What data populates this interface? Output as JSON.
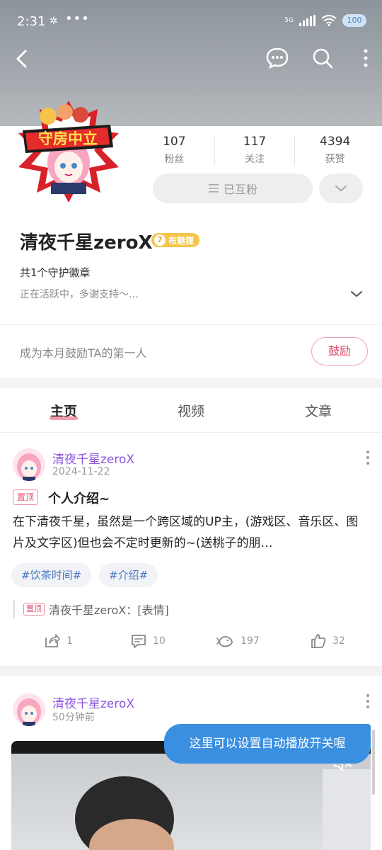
{
  "status_bar": {
    "time": "2:31",
    "network": "5G",
    "battery": "100"
  },
  "nav": {
    "back": "back-arrow-icon"
  },
  "profile": {
    "stats": [
      {
        "value": "107",
        "label": "粉丝"
      },
      {
        "value": "117",
        "label": "关注"
      },
      {
        "value": "4394",
        "label": "获赞"
      }
    ],
    "mutual_label": "已互粉",
    "name": "清夜千星zeroX",
    "level": "7",
    "level_title": "布魅狸",
    "guard_badges": "共1个守护徽章",
    "signature": "正在活跃中，多谢支持～…",
    "avatar_banner_text": "守房中立"
  },
  "encourage": {
    "text": "成为本月鼓励TA的第一人",
    "button": "鼓励"
  },
  "tabs": [
    {
      "label": "主页",
      "active": true
    },
    {
      "label": "视频"
    },
    {
      "label": "文章"
    }
  ],
  "posts": [
    {
      "author": "清夜千星zeroX",
      "time": "2024-11-22",
      "pin_label": "置顶",
      "title": "个人介绍~",
      "body": "在下清夜千星，虽然是一个跨区域的UP主，(游戏区、音乐区、图片及文字区)但也会不定时更新的~(送桃子的朋…",
      "hashtags": [
        "#饮茶时间#",
        "#介绍#"
      ],
      "quote_pin": "置顶",
      "quote_text": "清夜千星zeroX：[表情]",
      "actions": {
        "share": "1",
        "comment": "10",
        "fish": "197",
        "like": "32"
      }
    },
    {
      "author": "清夜千星zeroX",
      "time": "50分钟前"
    }
  ],
  "tooltip": "这里可以设置自动播放开关喔",
  "colors": {
    "accent_pink": "#e14b6e",
    "author_purple": "#8e54e0",
    "tag_blue": "#4a78c2",
    "tooltip_blue": "#3a8fe0",
    "level_gold": "#f5c54a"
  }
}
